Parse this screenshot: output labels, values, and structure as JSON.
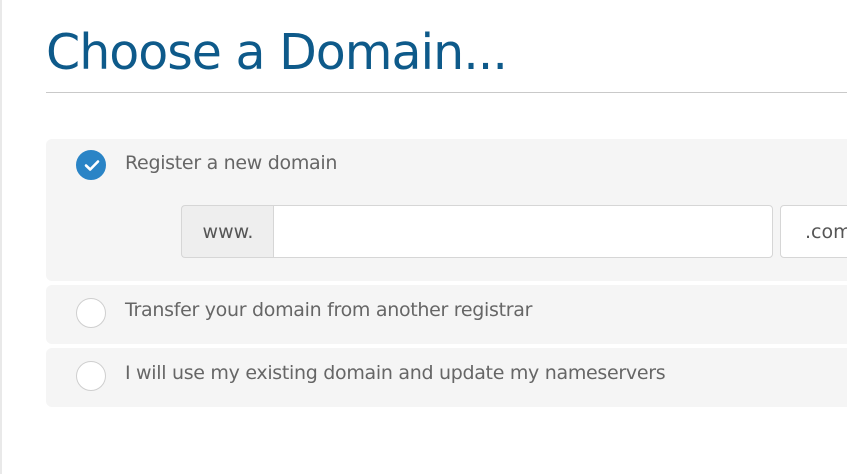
{
  "page": {
    "title": "Choose a Domain..."
  },
  "options": [
    {
      "label": "Register a new domain",
      "selected": true
    },
    {
      "label": "Transfer your domain from another registrar",
      "selected": false
    },
    {
      "label": "I will use my existing domain and update my nameservers",
      "selected": false
    }
  ],
  "register": {
    "prefix": "www.",
    "domain_value": "",
    "domain_placeholder": "",
    "tld_selected": ".com"
  },
  "colors": {
    "title": "#0e5a8a",
    "accent": "#2a84c6",
    "option_background": "#f5f5f5",
    "label_text": "#666666"
  },
  "icons": {
    "selected_radio": "checkmark-circle-icon"
  }
}
